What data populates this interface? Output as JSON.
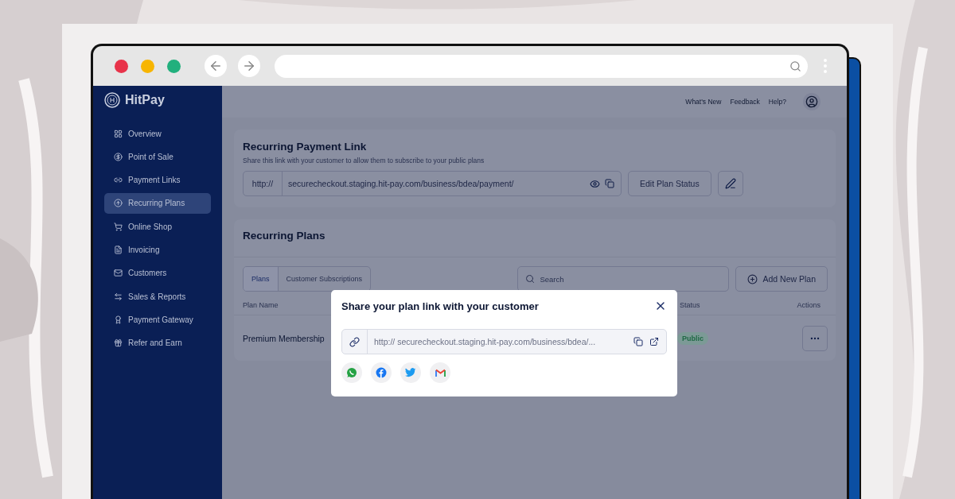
{
  "app": {
    "logo": "HitPay"
  },
  "sidebar": {
    "items": [
      {
        "label": "Overview",
        "selected": false
      },
      {
        "label": "Point of Sale",
        "selected": false
      },
      {
        "label": "Payment Links",
        "selected": false
      },
      {
        "label": "Recurring Plans",
        "selected": true
      },
      {
        "label": "Online Shop",
        "selected": false
      },
      {
        "label": "Invoicing",
        "selected": false
      },
      {
        "label": "Customers",
        "selected": false
      },
      {
        "label": "Sales & Reports",
        "selected": false
      },
      {
        "label": "Payment Gateway",
        "selected": false
      },
      {
        "label": "Refer and Earn",
        "selected": false
      }
    ]
  },
  "header": {
    "links": [
      "What's New",
      "Feedback",
      "Help?"
    ]
  },
  "payment_link": {
    "title": "Recurring Payment Link",
    "description": "Share this link with your customer to allow them to subscribe to your public plans",
    "prefix": "http://",
    "url": "securecheckout.staging.hit-pay.com/business/bdea/payment/",
    "edit_button": "Edit Plan Status"
  },
  "plans": {
    "title": "Recurring Plans",
    "tabs": [
      {
        "label": "Plans",
        "selected": true
      },
      {
        "label": "Customer Subscriptions",
        "selected": false
      }
    ],
    "search_placeholder": "Search",
    "add_button": "Add New Plan",
    "columns": [
      "Plan Name",
      "Status",
      "Actions"
    ],
    "rows": [
      {
        "name": "Premium Membership",
        "status": "Public"
      }
    ]
  },
  "modal": {
    "title": "Share your plan link with your customer",
    "link": "http:// securecheckout.staging.hit-pay.com/business/bdea/..."
  }
}
